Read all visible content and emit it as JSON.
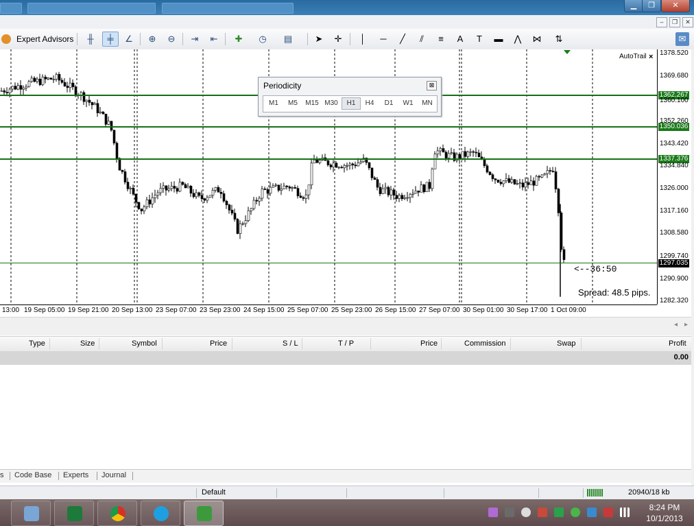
{
  "toolbar": {
    "expert_advisors_label": "Expert Advisors"
  },
  "chart": {
    "autotrail_label": "AutoTrail",
    "autotrail_close": "×",
    "countdown": "<--36:50",
    "spread": "Spread: 48.5 pips.",
    "price_labels": [
      "1378.520",
      "1369.680",
      "1360.100",
      "1352.260",
      "1343.420",
      "1334.840",
      "1326.000",
      "1317.160",
      "1308.580",
      "1299.740",
      "1290.900",
      "1282.320"
    ],
    "time_labels": [
      "13:00",
      "19 Sep 05:00",
      "19 Sep 21:00",
      "20 Sep 13:00",
      "23 Sep 07:00",
      "23 Sep 23:00",
      "24 Sep 15:00",
      "25 Sep 07:00",
      "25 Sep 23:00",
      "26 Sep 15:00",
      "27 Sep 07:00",
      "30 Sep 01:00",
      "30 Sep 17:00",
      "1 Oct 09:00"
    ],
    "levels": [
      "1362.267",
      "1350.036",
      "1337.376",
      "1297.035"
    ]
  },
  "chart_data": {
    "type": "candlestick",
    "ylim": [
      1282.32,
      1378.52
    ],
    "x": [
      "19 Sep 05:00",
      "19 Sep 21:00",
      "20 Sep 13:00",
      "23 Sep 07:00",
      "23 Sep 23:00",
      "24 Sep 15:00",
      "25 Sep 07:00",
      "25 Sep 23:00",
      "26 Sep 15:00",
      "27 Sep 07:00",
      "30 Sep 01:00",
      "30 Sep 17:00",
      "1 Oct 09:00"
    ],
    "close_approx": [
      1366,
      1362,
      1322,
      1326,
      1314,
      1326,
      1338,
      1334,
      1326,
      1342,
      1335,
      1328,
      1297
    ],
    "horizontal_levels": [
      1362.267,
      1350.036,
      1337.376,
      1297.035
    ],
    "last_price": 1297.035
  },
  "periodicity": {
    "title": "Periodicity",
    "close": "⊠",
    "buttons": [
      "M1",
      "M5",
      "M15",
      "M30",
      "H1",
      "H4",
      "D1",
      "W1",
      "MN"
    ],
    "selected": "H1"
  },
  "terminal": {
    "columns": [
      "Type",
      "Size",
      "Symbol",
      "Price",
      "S / L",
      "T / P",
      "Price",
      "Commission",
      "Swap",
      "Profit"
    ],
    "balance_profit": "0.00",
    "tabs": [
      "s",
      "Code Base",
      "Experts",
      "Journal"
    ]
  },
  "statusbar": {
    "profile": "Default",
    "traffic": "20940/18 kb"
  },
  "taskbar": {
    "time": "8:24 PM",
    "date": "10/1/2013"
  },
  "colors": {
    "level_line": "#157015",
    "title_bar": "#2a6aa0"
  }
}
